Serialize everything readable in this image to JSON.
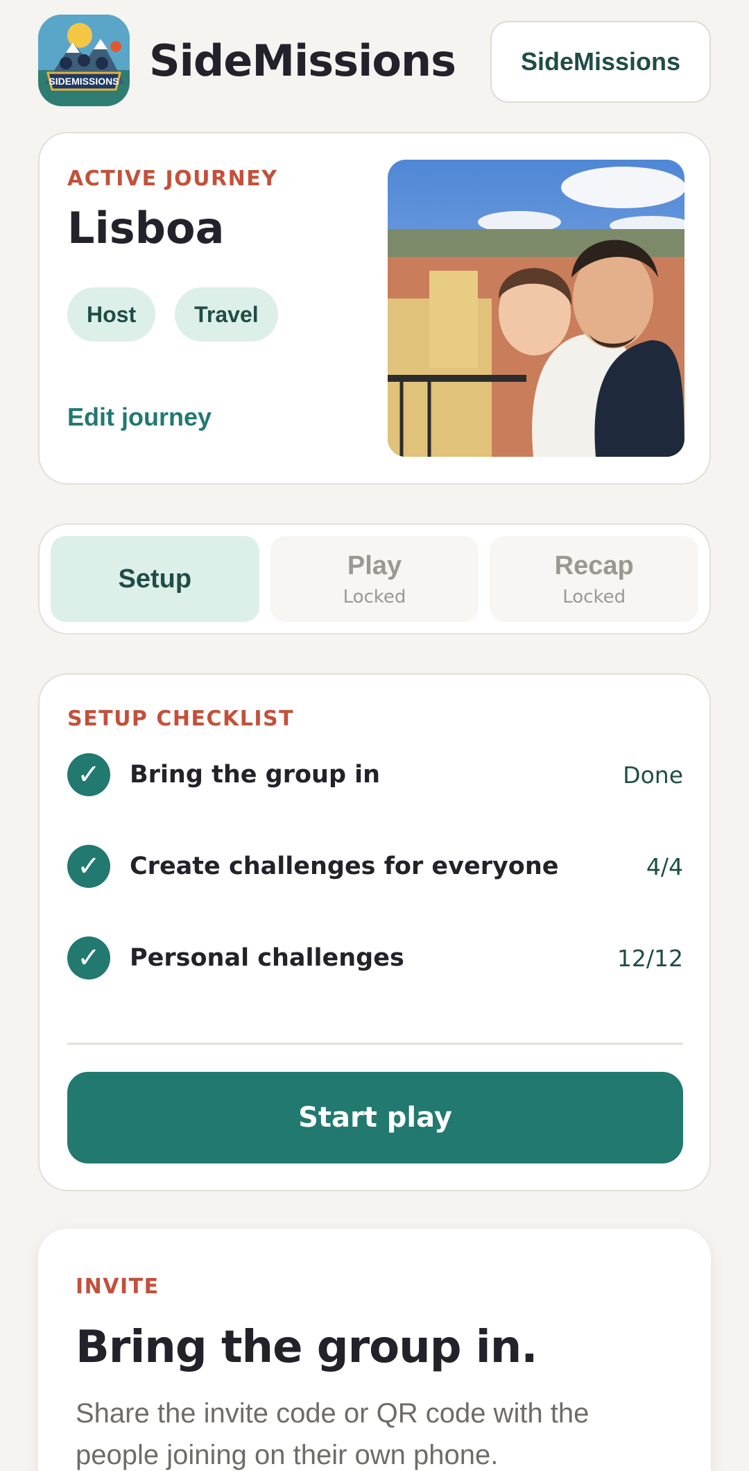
{
  "header": {
    "logo_text": "SIDEMISSIONS",
    "app_title": "SideMissions",
    "button_label": "SideMissions"
  },
  "journey": {
    "eyebrow": "ACTIVE JOURNEY",
    "name": "Lisboa",
    "tags": [
      "Host",
      "Travel"
    ],
    "edit_label": "Edit journey"
  },
  "tabs": [
    {
      "label": "Setup",
      "sub": "",
      "active": true
    },
    {
      "label": "Play",
      "sub": "Locked",
      "active": false
    },
    {
      "label": "Recap",
      "sub": "Locked",
      "active": false
    }
  ],
  "checklist": {
    "eyebrow": "SETUP CHECKLIST",
    "items": [
      {
        "label": "Bring the group in",
        "status": "Done"
      },
      {
        "label": "Create challenges for everyone",
        "status": "4/4"
      },
      {
        "label": "Personal challenges",
        "status": "12/12"
      }
    ],
    "button_label": "Start play"
  },
  "invite": {
    "eyebrow": "INVITE",
    "title": "Bring the group in.",
    "text": "Share the invite code or QR code with the people joining on their own phone."
  },
  "colors": {
    "accent": "#217970",
    "eyebrow": "#c4503a",
    "background": "#f5f4f0"
  }
}
